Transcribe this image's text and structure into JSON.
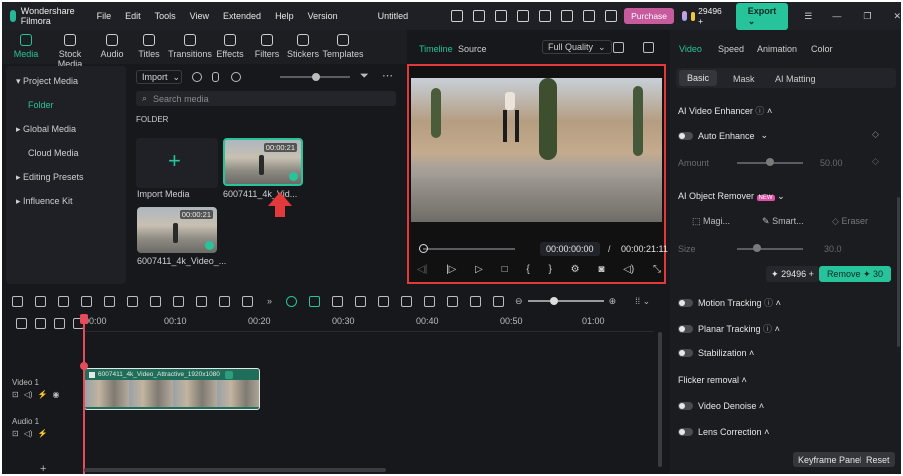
{
  "titlebar": {
    "app_name": "Wondershare Filmora",
    "menus": [
      "File",
      "Edit",
      "Tools",
      "View",
      "Extended",
      "Help",
      "Version"
    ],
    "project_title": "Untitled",
    "purchase_label": "Purchase",
    "credits": "29496 +",
    "export_label": "Export"
  },
  "toolbar": {
    "tabs": [
      "Media",
      "Stock Media",
      "Audio",
      "Titles",
      "Transitions",
      "Effects",
      "Filters",
      "Stickers",
      "Templates"
    ]
  },
  "media_panel": {
    "sidebar": [
      "Project Media",
      "Folder",
      "Global Media",
      "Cloud Media",
      "Editing Presets",
      "Influence Kit"
    ],
    "import_label": "Import",
    "search_placeholder": "Search media",
    "folder_heading": "FOLDER",
    "import_tile_label": "Import Media",
    "clips": [
      {
        "name": "6007411_4k_Vid...",
        "duration": "00:00:21"
      },
      {
        "name": "6007411_4k_Video_...",
        "duration": "00:00:21"
      }
    ]
  },
  "player": {
    "tabs": [
      "Timeline",
      "Source"
    ],
    "quality": "Full Quality",
    "current_time": "00:00:00:00",
    "separator": "/",
    "total_time": "00:00:21:11"
  },
  "properties": {
    "tabs": [
      "Video",
      "Speed",
      "Animation",
      "Color"
    ],
    "subtabs": [
      "Basic",
      "Mask",
      "AI Matting"
    ],
    "ai_enhancer": "AI Video Enhancer",
    "auto_enhance": "Auto Enhance",
    "amount_label": "Amount",
    "amount_value": "50.00",
    "ai_remover": "AI Object Remover",
    "new_badge": "NEW",
    "tools": [
      "Magi...",
      "Smart...",
      "Eraser"
    ],
    "size_label": "Size",
    "size_value": "30.0",
    "credits_value": "29496 +",
    "remove_label": "Remove",
    "remove_cost": "30",
    "sections": [
      "Motion Tracking",
      "Planar Tracking",
      "Stabilization"
    ],
    "flicker": "Flicker removal",
    "sections2": [
      "Video Denoise",
      "Lens Correction"
    ],
    "keyframe_label": "Keyframe Panel",
    "reset_label": "Reset"
  },
  "timeline": {
    "ruler": [
      "00:00",
      "00:10",
      "00:20",
      "00:30",
      "00:40",
      "00:50",
      "01:00"
    ],
    "video_track": "Video 1",
    "audio_track": "Audio 1",
    "clip_name": "6007411_4k_Video_Attractive_1920x1080"
  },
  "colors": {
    "accent": "#27c39b",
    "highlight": "#e23a3a",
    "purchase": "#c85a9e"
  }
}
